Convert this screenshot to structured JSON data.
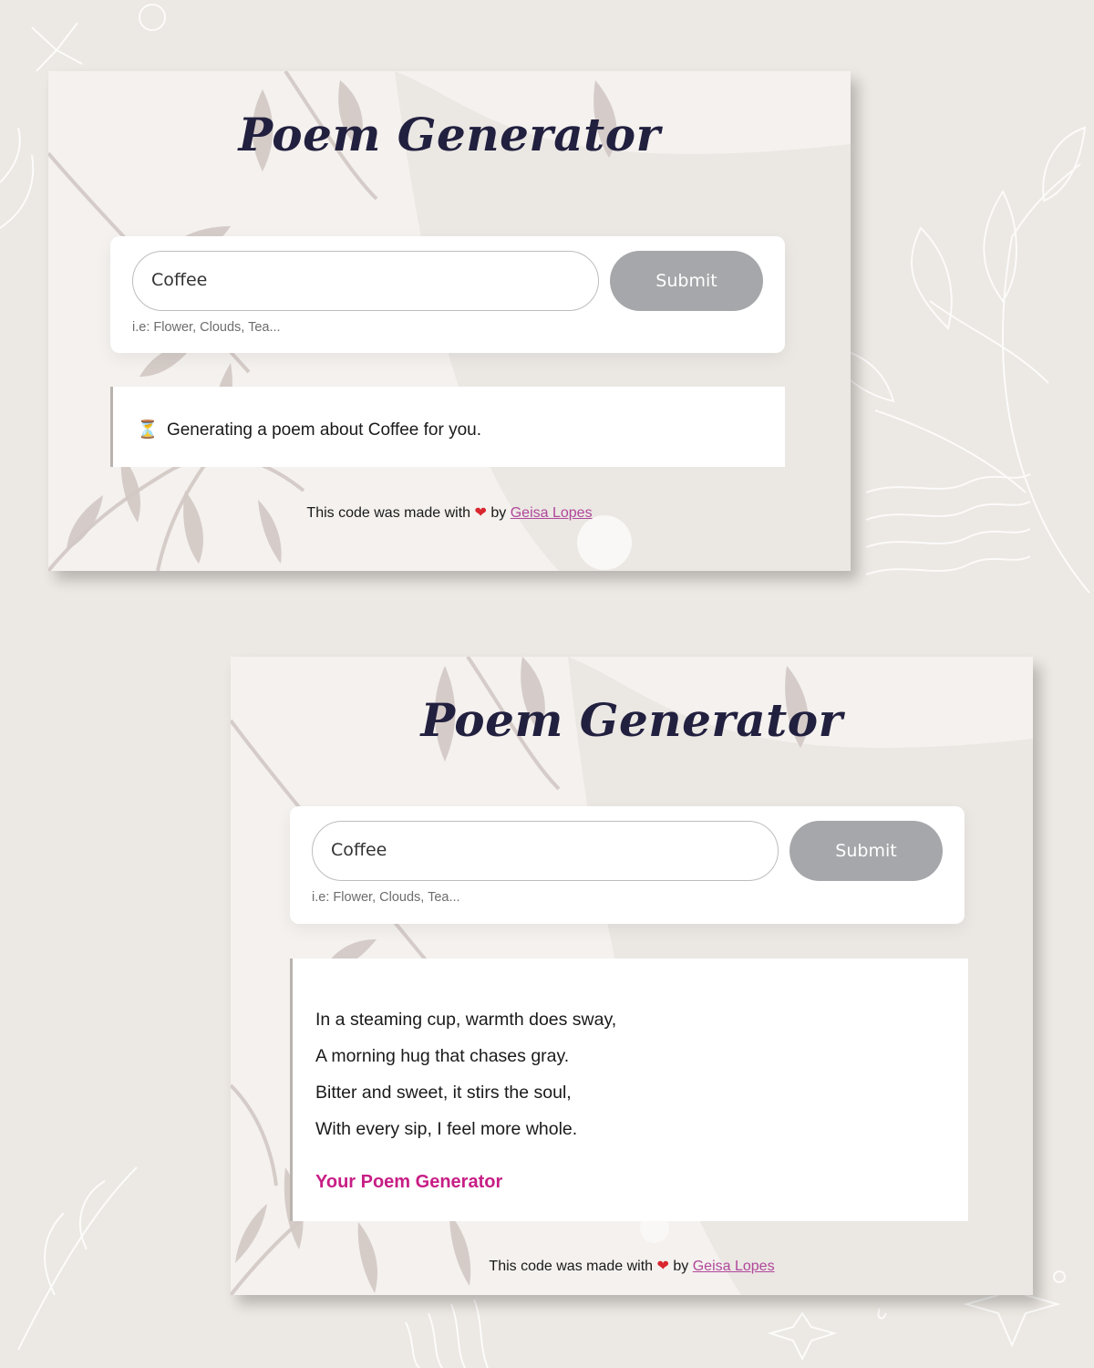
{
  "colors": {
    "page_background": "#ece8e3",
    "card_background": "#f4f1ee",
    "title": "#22203f",
    "submit_button": "#a6a7aa",
    "signature": "#c71e85",
    "link": "#b0479b",
    "heart": "#d9262f"
  },
  "loading_screen": {
    "title": "Poem Generator",
    "input_value": "Coffee",
    "submit_label": "Submit",
    "hint": "i.e: Flower, Clouds, Tea...",
    "status_icon": "hourglass-icon",
    "status_glyph": "⏳",
    "status_text": "Generating a poem about Coffee for you.",
    "footer": {
      "text_before": "This code was made with",
      "heart_icon": "heart-icon",
      "heart_glyph": "❤",
      "text_by": "by",
      "author": "Geisa Lopes"
    }
  },
  "result_screen": {
    "title": "Poem Generator",
    "input_value": "Coffee",
    "submit_label": "Submit",
    "hint": "i.e: Flower, Clouds, Tea...",
    "poem_lines": [
      "In a steaming cup, warmth does sway,",
      "A morning hug that chases gray.",
      "Bitter and sweet, it stirs the soul,",
      "With every sip, I feel more whole."
    ],
    "signature": "Your Poem Generator",
    "footer": {
      "text_before": "This code was made with",
      "heart_icon": "heart-icon",
      "heart_glyph": "❤",
      "text_by": "by",
      "author": "Geisa Lopes"
    }
  }
}
